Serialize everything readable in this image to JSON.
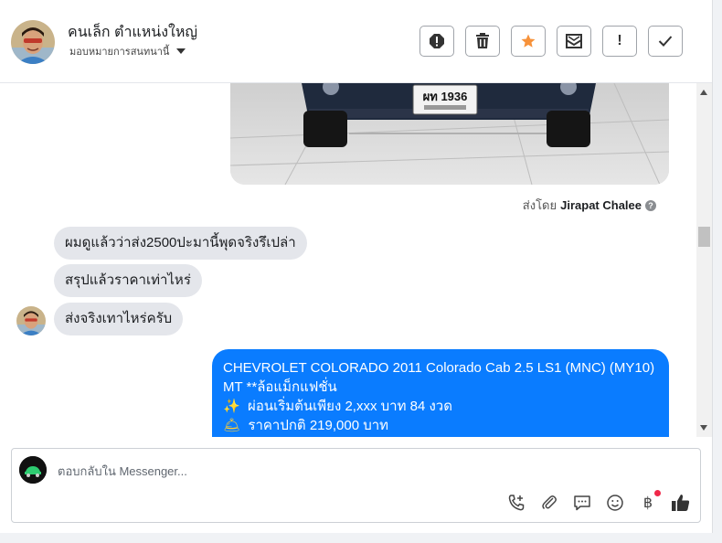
{
  "header": {
    "contact_name": "คนเล็ก ตำแหน่งใหญ่",
    "assign_label": "มอบหมายการสนทนานี้"
  },
  "thread": {
    "plate_text": "ผท 1936",
    "sent_by_prefix": "ส่งโดย",
    "sent_by_name": "Jirapat Chalee",
    "incoming": [
      "ผมดูแล้วว่าส่ง2500ปะมานี้พุดจริงรึเปล่า",
      "สรุปแล้วราคาเท่าไหร่",
      "ส่งจริงเทาไหร่ครับ"
    ],
    "outgoing": {
      "line1": "CHEVROLET COLORADO 2011 Colorado Cab 2.5 LS1 (MNC) (MY10)",
      "line2": "MT **ล้อแม็กแฟชั่น",
      "line3_icon": "✨",
      "line3": "ผ่อนเริ่มต้นเพียง 2,xxx บาท 84 งวด",
      "line4_icon": "🛎",
      "line4": "ราคาปกติ 219,000 บาท"
    }
  },
  "composer": {
    "placeholder": "ตอบกลับใน Messenger..."
  },
  "icons": {
    "report": "alert-circle-icon",
    "delete": "trash-icon",
    "star": "star-icon",
    "mail": "mail-icon",
    "exclaim": "exclamation-icon",
    "check": "check-icon"
  },
  "colors": {
    "accent": "#0a7cff",
    "star": "#f7923a",
    "notification": "#f02849"
  }
}
